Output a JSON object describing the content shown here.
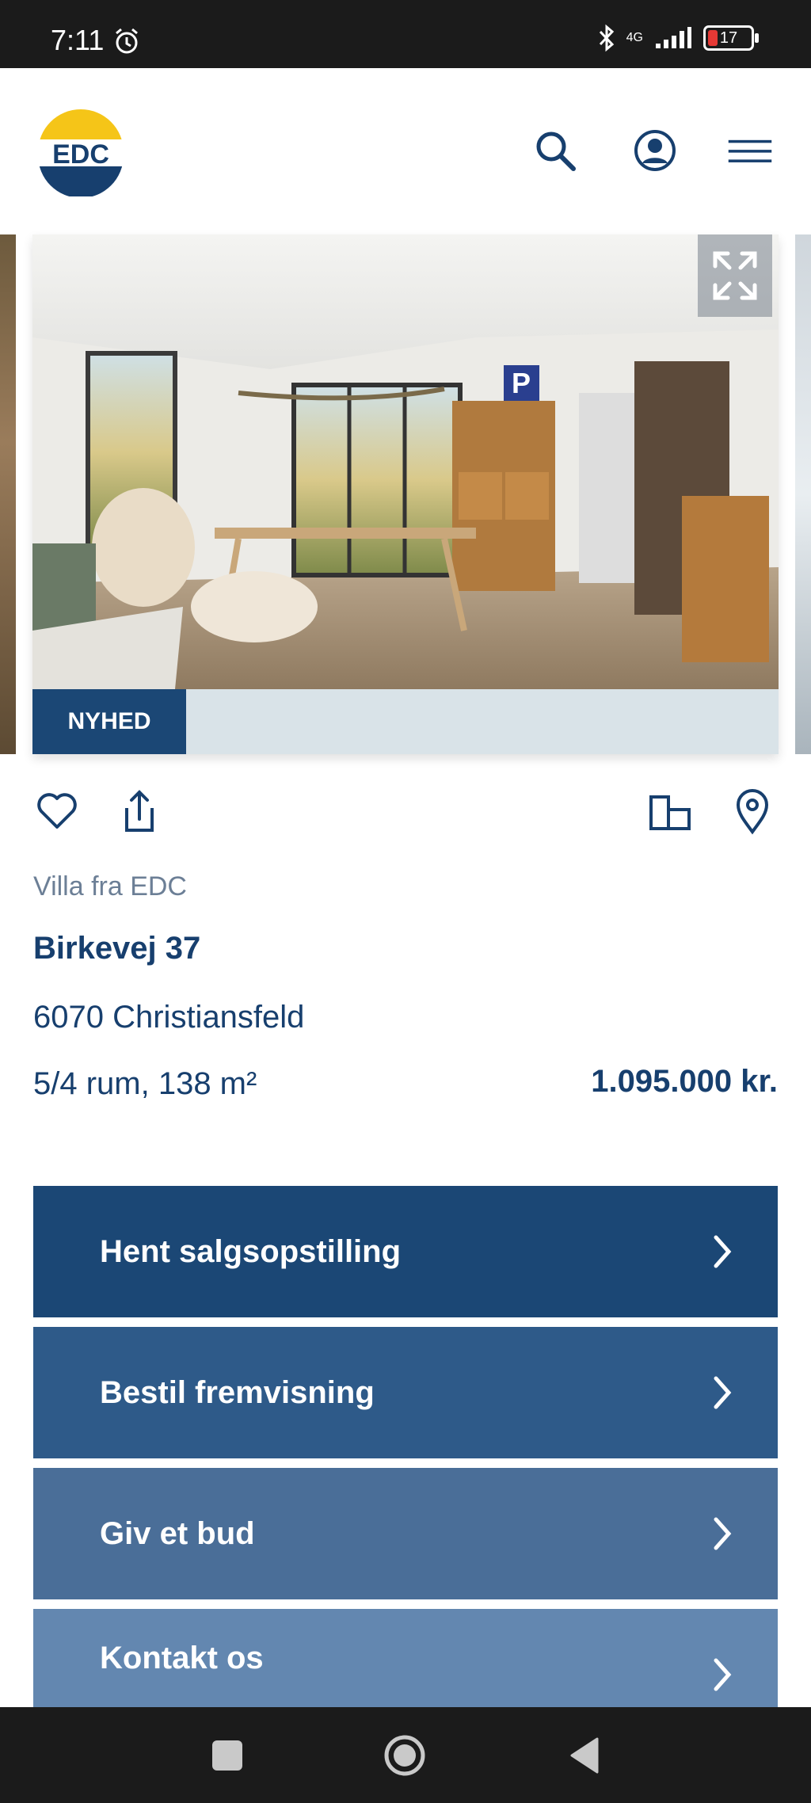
{
  "status_bar": {
    "time": "7:11",
    "network": "4G",
    "battery": "17"
  },
  "header": {
    "logo_text": "EDC"
  },
  "gallery": {
    "badge": "NYHED"
  },
  "listing": {
    "subtitle": "Villa fra EDC",
    "street": "Birkevej 37",
    "city": "6070 Christiansfeld",
    "rooms_size": "5/4 rum, 138 m²",
    "price": "1.095.000 kr."
  },
  "buttons": [
    {
      "label": "Hent salgsopstilling"
    },
    {
      "label": "Bestil fremvisning"
    },
    {
      "label": "Giv et bud"
    },
    {
      "label": "Kontakt os"
    }
  ],
  "colors": {
    "brand_dark": "#1b4775",
    "brand_yellow": "#f5c518",
    "text": "#173f6e"
  }
}
